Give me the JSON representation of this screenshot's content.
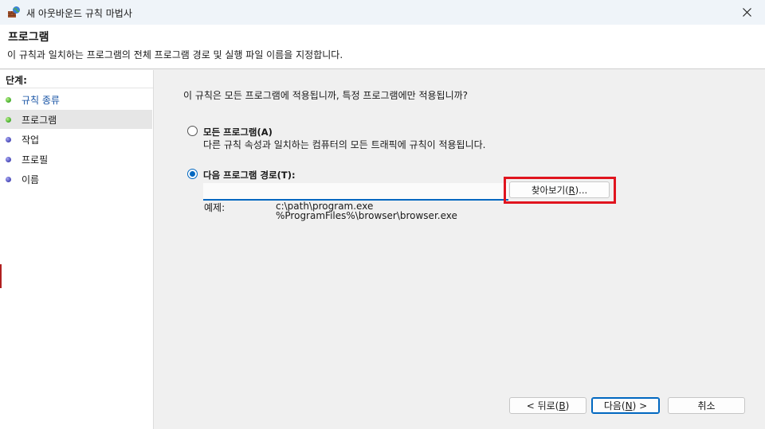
{
  "window": {
    "title": "새 아웃바운드 규칙 마법사",
    "close_icon": "close-icon",
    "app_icon": "firewall-wizard-icon"
  },
  "header": {
    "title": "프로그램",
    "description": "이 규칙과 일치하는 프로그램의 전체 프로그램 경로 및 실행 파일 이름을 지정합니다."
  },
  "steps": {
    "heading": "단계:",
    "items": [
      {
        "label": "규칙 종류",
        "status": "done"
      },
      {
        "label": "프로그램",
        "status": "current"
      },
      {
        "label": "작업",
        "status": "todo"
      },
      {
        "label": "프로필",
        "status": "todo"
      },
      {
        "label": "이름",
        "status": "todo"
      }
    ]
  },
  "main": {
    "question": "이 규칙은 모든 프로그램에 적용됩니까, 특정 프로그램에만 적용됩니까?",
    "option_all": {
      "label": "모든 프로그램(A)",
      "description": "다른 규칙 속성과 일치하는 컴퓨터의 모든 트래픽에 규칙이 적용됩니다.",
      "selected": false
    },
    "option_path": {
      "label": "다음 프로그램 경로(T):",
      "selected": true,
      "value": "",
      "browse_label_pre": "찾아보기(",
      "browse_label_key": "R",
      "browse_label_post": ")...",
      "example_label": "예제:",
      "example_lines": [
        "c:\\path\\program.exe",
        "%ProgramFiles%\\browser\\browser.exe"
      ]
    }
  },
  "footer": {
    "back_pre": "< 뒤로(",
    "back_key": "B",
    "back_post": ")",
    "next_pre": "다음(",
    "next_key": "N",
    "next_post": ") >",
    "cancel": "취소"
  },
  "colors": {
    "accent": "#0067c0",
    "highlight_box": "#e0141e",
    "done_dot": "#3faa28",
    "todo_dot": "#4545b5"
  }
}
